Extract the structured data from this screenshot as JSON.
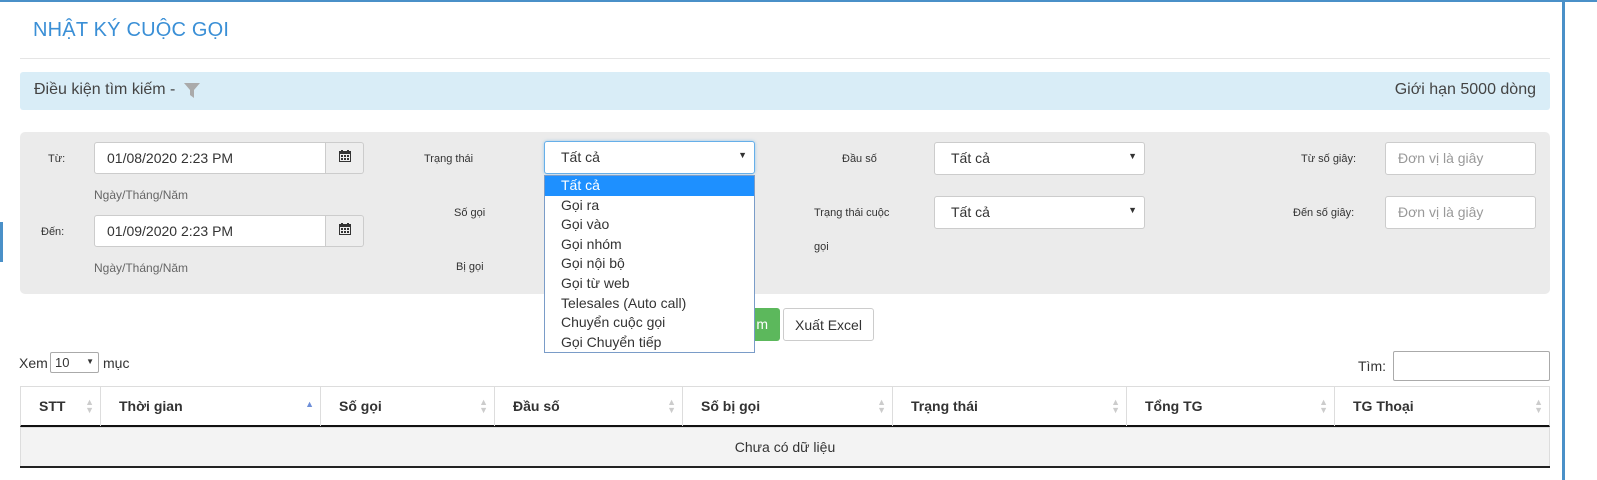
{
  "page": {
    "title": "NHẬT KÝ CUỘC GỌI"
  },
  "conditions": {
    "label": "Điều kiện tìm kiếm -",
    "limit": "Giới hạn 5000 dòng"
  },
  "filters": {
    "from": {
      "label": "Từ:",
      "value": "01/08/2020 2:23 PM",
      "hint": "Ngày/Tháng/Năm"
    },
    "to": {
      "label": "Đến:",
      "value": "01/09/2020 2:23 PM",
      "hint": "Ngày/Tháng/Năm"
    },
    "status": {
      "label": "Trạng thái",
      "value": "Tất cả",
      "options": [
        "Tất cả",
        "Gọi ra",
        "Gọi vào",
        "Gọi nhóm",
        "Gọi nội bộ",
        "Gọi từ web",
        "Telesales (Auto call)",
        "Chuyển cuộc gọi",
        "Gọi Chuyển tiếp"
      ]
    },
    "caller_label": "Số gọi",
    "callee_label": "Bị gọi",
    "prefix": {
      "label": "Đầu số",
      "value": "Tất cả"
    },
    "call_state": {
      "label_line1": "Trạng thái cuộc",
      "label_line2": "gọi",
      "value": "Tất cả"
    },
    "from_seconds": {
      "label": "Từ số giây:",
      "placeholder": "Đơn vị là giây"
    },
    "to_seconds": {
      "label": "Đến số giây:",
      "placeholder": "Đơn vị là giây"
    }
  },
  "actions": {
    "search_label_visible": "m",
    "export_label": "Xuất Excel"
  },
  "table_controls": {
    "show_label": "Xem",
    "page_size": "10",
    "entries_label": "mục",
    "search_label": "Tìm:"
  },
  "table": {
    "columns": [
      "STT",
      "Thời gian",
      "Số gọi",
      "Đầu số",
      "Số bị gọi",
      "Trạng thái",
      "Tổng TG",
      "TG Thoại"
    ],
    "empty_text": "Chưa có dữ liệu"
  },
  "colors": {
    "accent": "#3a8fd6",
    "info_bar": "#d9edf7",
    "success": "#5cb85c",
    "dropdown_selected": "#1e90ff"
  }
}
